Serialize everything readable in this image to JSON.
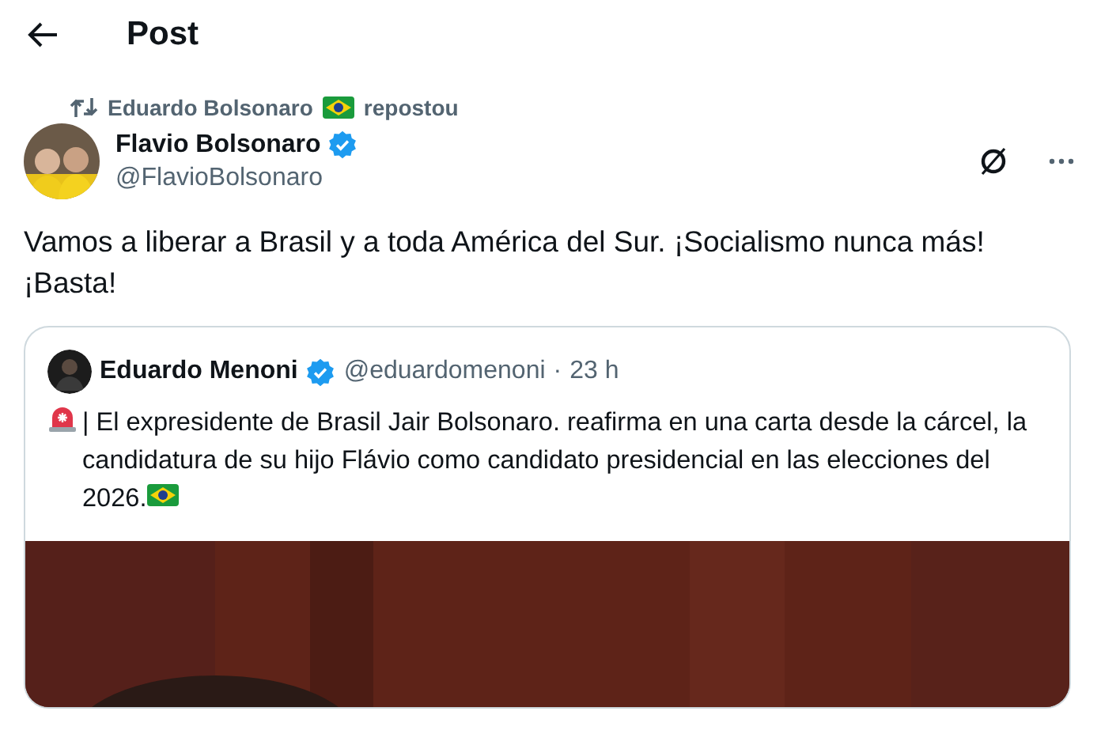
{
  "header": {
    "title": "Post"
  },
  "repost": {
    "name": "Eduardo Bolsonaro",
    "suffix": "repostou"
  },
  "post": {
    "name": "Flavio Bolsonaro",
    "verified": true,
    "handle": "@FlavioBolsonaro",
    "text": "Vamos a liberar a Brasil y a toda América del Sur. ¡Socialismo nunca más! ¡Basta!",
    "quote": {
      "name": "Eduardo Menoni",
      "verified": true,
      "handle": "@eduardomenoni",
      "separator": "·",
      "time": "23 h",
      "text": "| El expresidente de Brasil Jair Bolsonaro. reafirma en una carta desde la cárcel, la candidatura de su hijo Flávio como candidato presidencial en las elecciones del 2026."
    }
  }
}
